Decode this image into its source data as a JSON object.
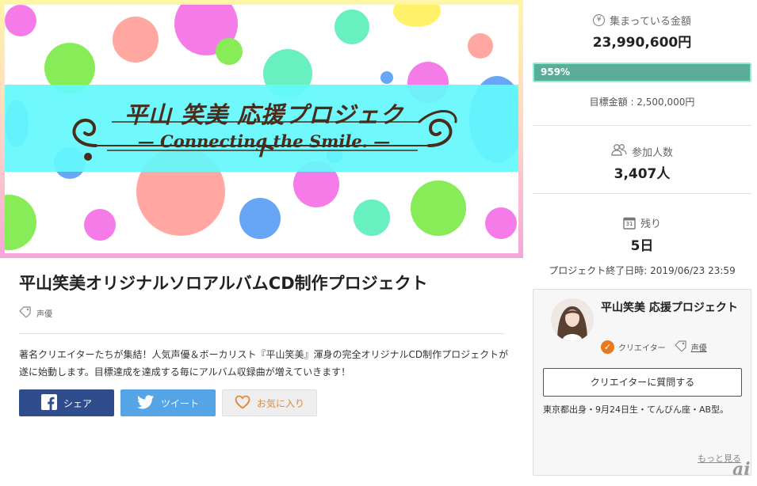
{
  "hero": {
    "logo_title": "平山 笑美 応援プロジェクト",
    "logo_subtitle": "— Connecting the Smile. —"
  },
  "project": {
    "title": "平山笑美オリジナルソロアルバムCD制作プロジェクト",
    "tag": "声優",
    "description": "著名クリエイターたちが集結！人気声優＆ボーカリスト『平山笑美』渾身の完全オリジナルCD制作プロジェクトが遂に始動します。目標達成を達成する毎にアルバム収録曲が増えていきます！"
  },
  "share": {
    "facebook_label": "シェア",
    "twitter_label": "ツイート",
    "favorite_label": "お気に入り"
  },
  "stats": {
    "yen_symbol": "¥",
    "raised_label": "集まっている金額",
    "raised_value": "23,990,600円",
    "progress_label": "959%",
    "progress_fraction": 1.0,
    "goal_text": "目標金額 : 2,500,000円",
    "participants_label": "参加人数",
    "participants_value": "3,407人",
    "calendar_day": "31",
    "remaining_label": "残り",
    "remaining_value": "5日",
    "end_date_text": "プロジェクト終了日時: 2019/06/23 23:59"
  },
  "creator": {
    "name": "平山笑美 応援プロジェクト",
    "role": "クリエイター",
    "tag": "声優",
    "ask_button": "クリエイターに質問する",
    "bio": "東京都出身・9月24日生・てんびん座・AB型。",
    "more_link": "もっと見る"
  },
  "watermark": "ai",
  "colors": {
    "progress_fill": "#5aad97",
    "facebook": "#2f4d8c",
    "twitter": "#54a4e6",
    "creator_badge": "#e8791f"
  }
}
